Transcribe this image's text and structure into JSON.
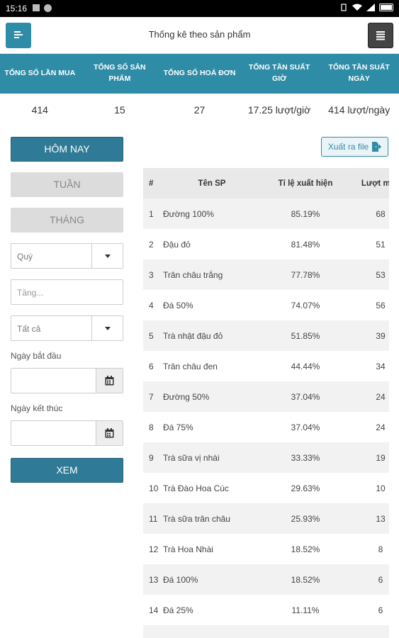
{
  "status": {
    "time": "15:16"
  },
  "header": {
    "title": "Thống kê theo sản phẩm"
  },
  "stats": {
    "headers": [
      "TỔNG SỐ LẦN MUA",
      "TỔNG SỐ SẢN PHẨM",
      "TỔNG SỐ HOÁ ĐƠN",
      "TỔNG TẦN SUẤT GIỜ",
      "TỔNG TẦN SUẤT NGÀY"
    ],
    "values": [
      "414",
      "15",
      "27",
      "17.25 lượt/giờ",
      "414 lượt/ngày"
    ]
  },
  "filters": {
    "today": "HÔM NAY",
    "week": "TUẦN",
    "month": "THÁNG",
    "quarter": "Quý",
    "floor_placeholder": "Tầng...",
    "scope": "Tất cả",
    "start_label": "Ngày bắt đầu",
    "end_label": "Ngày kết thúc",
    "view": "XEM"
  },
  "export": {
    "label": "Xuất ra file"
  },
  "table": {
    "headers": [
      "#",
      "Tên SP",
      "Tỉ lệ xuất hiện",
      "Lượt mua"
    ],
    "rows": [
      [
        "1",
        "Đường 100%",
        "85.19%",
        "68"
      ],
      [
        "2",
        "Đậu đỏ",
        "81.48%",
        "51"
      ],
      [
        "3",
        "Trân châu trắng",
        "77.78%",
        "53"
      ],
      [
        "4",
        "Đá 50%",
        "74.07%",
        "56"
      ],
      [
        "5",
        "Trà nhật đậu đỏ",
        "51.85%",
        "39"
      ],
      [
        "6",
        "Trân châu đen",
        "44.44%",
        "34"
      ],
      [
        "7",
        "Đường 50%",
        "37.04%",
        "24"
      ],
      [
        "8",
        "Đá 75%",
        "37.04%",
        "24"
      ],
      [
        "9",
        "Trà sữa vị nhài",
        "33.33%",
        "19"
      ],
      [
        "10",
        "Trà Đào Hoa Cúc",
        "29.63%",
        "10"
      ],
      [
        "11",
        "Trà sữa trân châu",
        "25.93%",
        "13"
      ],
      [
        "12",
        "Trà Hoa Nhài",
        "18.52%",
        "8"
      ],
      [
        "13",
        "Đá 100%",
        "18.52%",
        "6"
      ],
      [
        "14",
        "Đá 25%",
        "11.11%",
        "6"
      ],
      [
        "",
        "",
        "",
        ""
      ]
    ]
  }
}
